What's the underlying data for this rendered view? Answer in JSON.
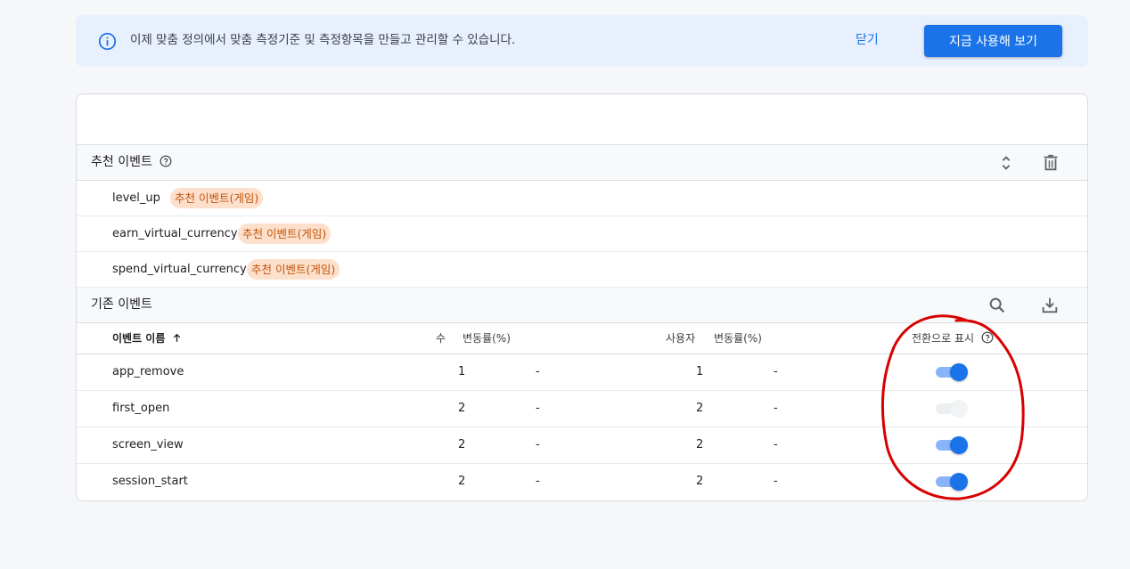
{
  "banner": {
    "message": "이제 맞춤 정의에서 맞춤 측정기준 및 측정항목을 만들고 관리할 수 있습니다.",
    "dismiss_label": "닫기",
    "cta_label": "지금 사용해 보기"
  },
  "recommended": {
    "title": "추천 이벤트",
    "chip_label": "추천 이벤트(게임)",
    "items": [
      {
        "name": "level_up"
      },
      {
        "name": "earn_virtual_currency"
      },
      {
        "name": "spend_virtual_currency"
      }
    ]
  },
  "existing": {
    "title": "기존 이벤트",
    "columns": {
      "event_name": "이벤트 이름",
      "count": "수",
      "count_change": "변동률(%)",
      "users": "사용자",
      "users_change": "변동률(%)",
      "conversion": "전환으로 표시"
    },
    "rows": [
      {
        "name": "app_remove",
        "count": "1",
        "count_change": "-",
        "users": "1",
        "users_change": "-",
        "conversion": true
      },
      {
        "name": "first_open",
        "count": "2",
        "count_change": "-",
        "users": "2",
        "users_change": "-",
        "conversion": false
      },
      {
        "name": "screen_view",
        "count": "2",
        "count_change": "-",
        "users": "2",
        "users_change": "-",
        "conversion": true
      },
      {
        "name": "session_start",
        "count": "2",
        "count_change": "-",
        "users": "2",
        "users_change": "-",
        "conversion": true
      }
    ]
  },
  "colors": {
    "accent": "#1a73e8",
    "chip_bg": "#fce0cc",
    "chip_text": "#c5530a",
    "annotation": "#d80000"
  },
  "icons": {
    "banner": "info-icon",
    "recommended_actions": [
      "expand-collapse-icon",
      "delete-icon"
    ],
    "existing_actions": [
      "search-icon",
      "download-icon"
    ],
    "sort": "arrow-up-icon",
    "help": "help-icon"
  }
}
